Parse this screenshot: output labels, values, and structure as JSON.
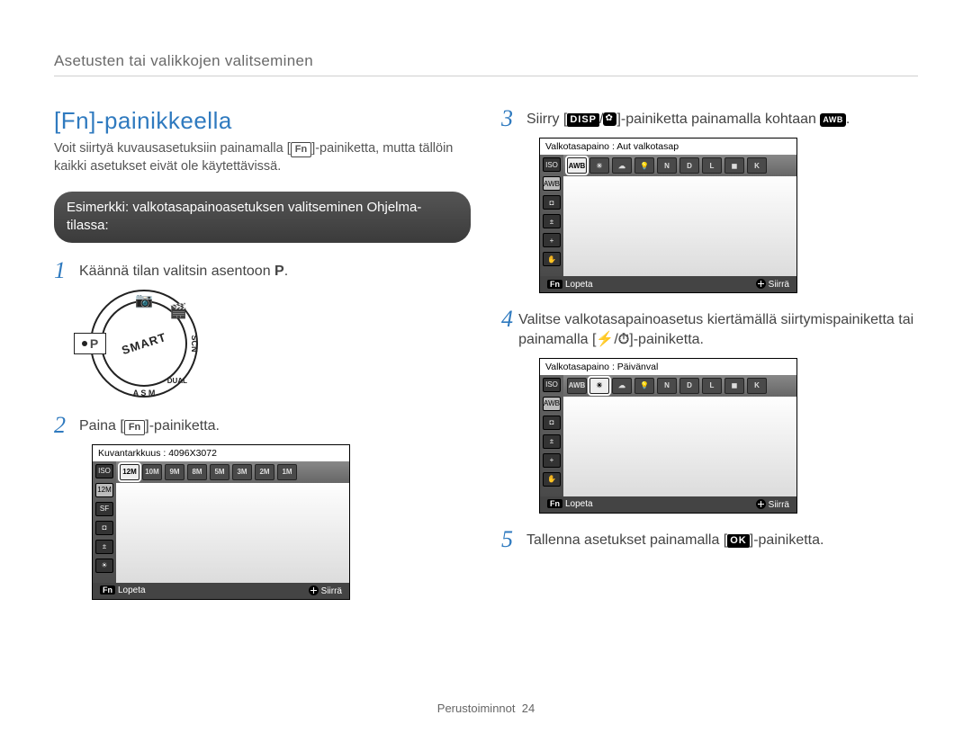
{
  "header": {
    "title": "Asetusten tai valikkojen valitseminen"
  },
  "section": {
    "title": "[Fn]-painikkeella",
    "intro_prefix": "Voit siirtyä kuvausasetuksiin painamalla [",
    "intro_fn": "Fn",
    "intro_suffix": "]-painiketta, mutta tällöin kaikki asetukset eivät ole käytettävissä.",
    "example_box": "Esimerkki: valkotasapainoasetuksen valitseminen Ohjelma-tilassa:"
  },
  "steps": {
    "1": {
      "num": "1",
      "text_prefix": "Käännä tilan valitsin asentoon ",
      "mode_letter": "P",
      "text_suffix": "."
    },
    "2": {
      "num": "2",
      "text_prefix": "Paina [",
      "fn": "Fn",
      "text_suffix": "]-painiketta."
    },
    "3": {
      "num": "3",
      "text_prefix": "Siirry [",
      "disp": "DISP",
      "sep": "/",
      "text_mid": "]-painiketta painamalla kohtaan ",
      "awb": "AWB",
      "text_suffix": "."
    },
    "4": {
      "num": "4",
      "text_prefix": "Valitse valkotasapainoasetus kiertämällä siirtymispainiketta tai painamalla [",
      "sep": "/",
      "text_suffix": "]-painiketta."
    },
    "5": {
      "num": "5",
      "text_prefix": "Tallenna asetukset painamalla [",
      "ok": "OK",
      "text_suffix": "]-painiketta."
    }
  },
  "dial": {
    "label": "SMART",
    "labels_bottom": [
      "A",
      "S",
      "M",
      "DUAL",
      "SCN"
    ]
  },
  "lcd1": {
    "header": "Kuvantarkkuus : 4096X3072",
    "sidebar": [
      "ISO",
      "12M",
      "SF",
      "◘",
      "±",
      "☀"
    ],
    "row": [
      "12M",
      "10M",
      "9M",
      "8M",
      "5M",
      "3M",
      "2M",
      "1M"
    ],
    "active_index": 0,
    "footer_left_badge": "Fn",
    "footer_left": "Lopeta",
    "footer_right": "Siirrä"
  },
  "lcd2": {
    "header": "Valkotasapaino : Aut valkotasap",
    "sidebar": [
      "ISO",
      "AWB",
      "◘",
      "±",
      "+",
      "✋"
    ],
    "row": [
      "AWB",
      "☀",
      "☁",
      "💡",
      "N",
      "D",
      "L",
      "◼",
      "K"
    ],
    "active_index": 0,
    "footer_left_badge": "Fn",
    "footer_left": "Lopeta",
    "footer_right": "Siirrä"
  },
  "lcd3": {
    "header": "Valkotasapaino : Päivänval",
    "sidebar": [
      "ISO",
      "AWB",
      "◘",
      "±",
      "+",
      "✋"
    ],
    "row": [
      "AWB",
      "☀",
      "☁",
      "💡",
      "N",
      "D",
      "L",
      "◼",
      "K"
    ],
    "active_index": 1,
    "footer_left_badge": "Fn",
    "footer_left": "Lopeta",
    "footer_right": "Siirrä"
  },
  "footer": {
    "section": "Perustoiminnot",
    "page": "24"
  }
}
